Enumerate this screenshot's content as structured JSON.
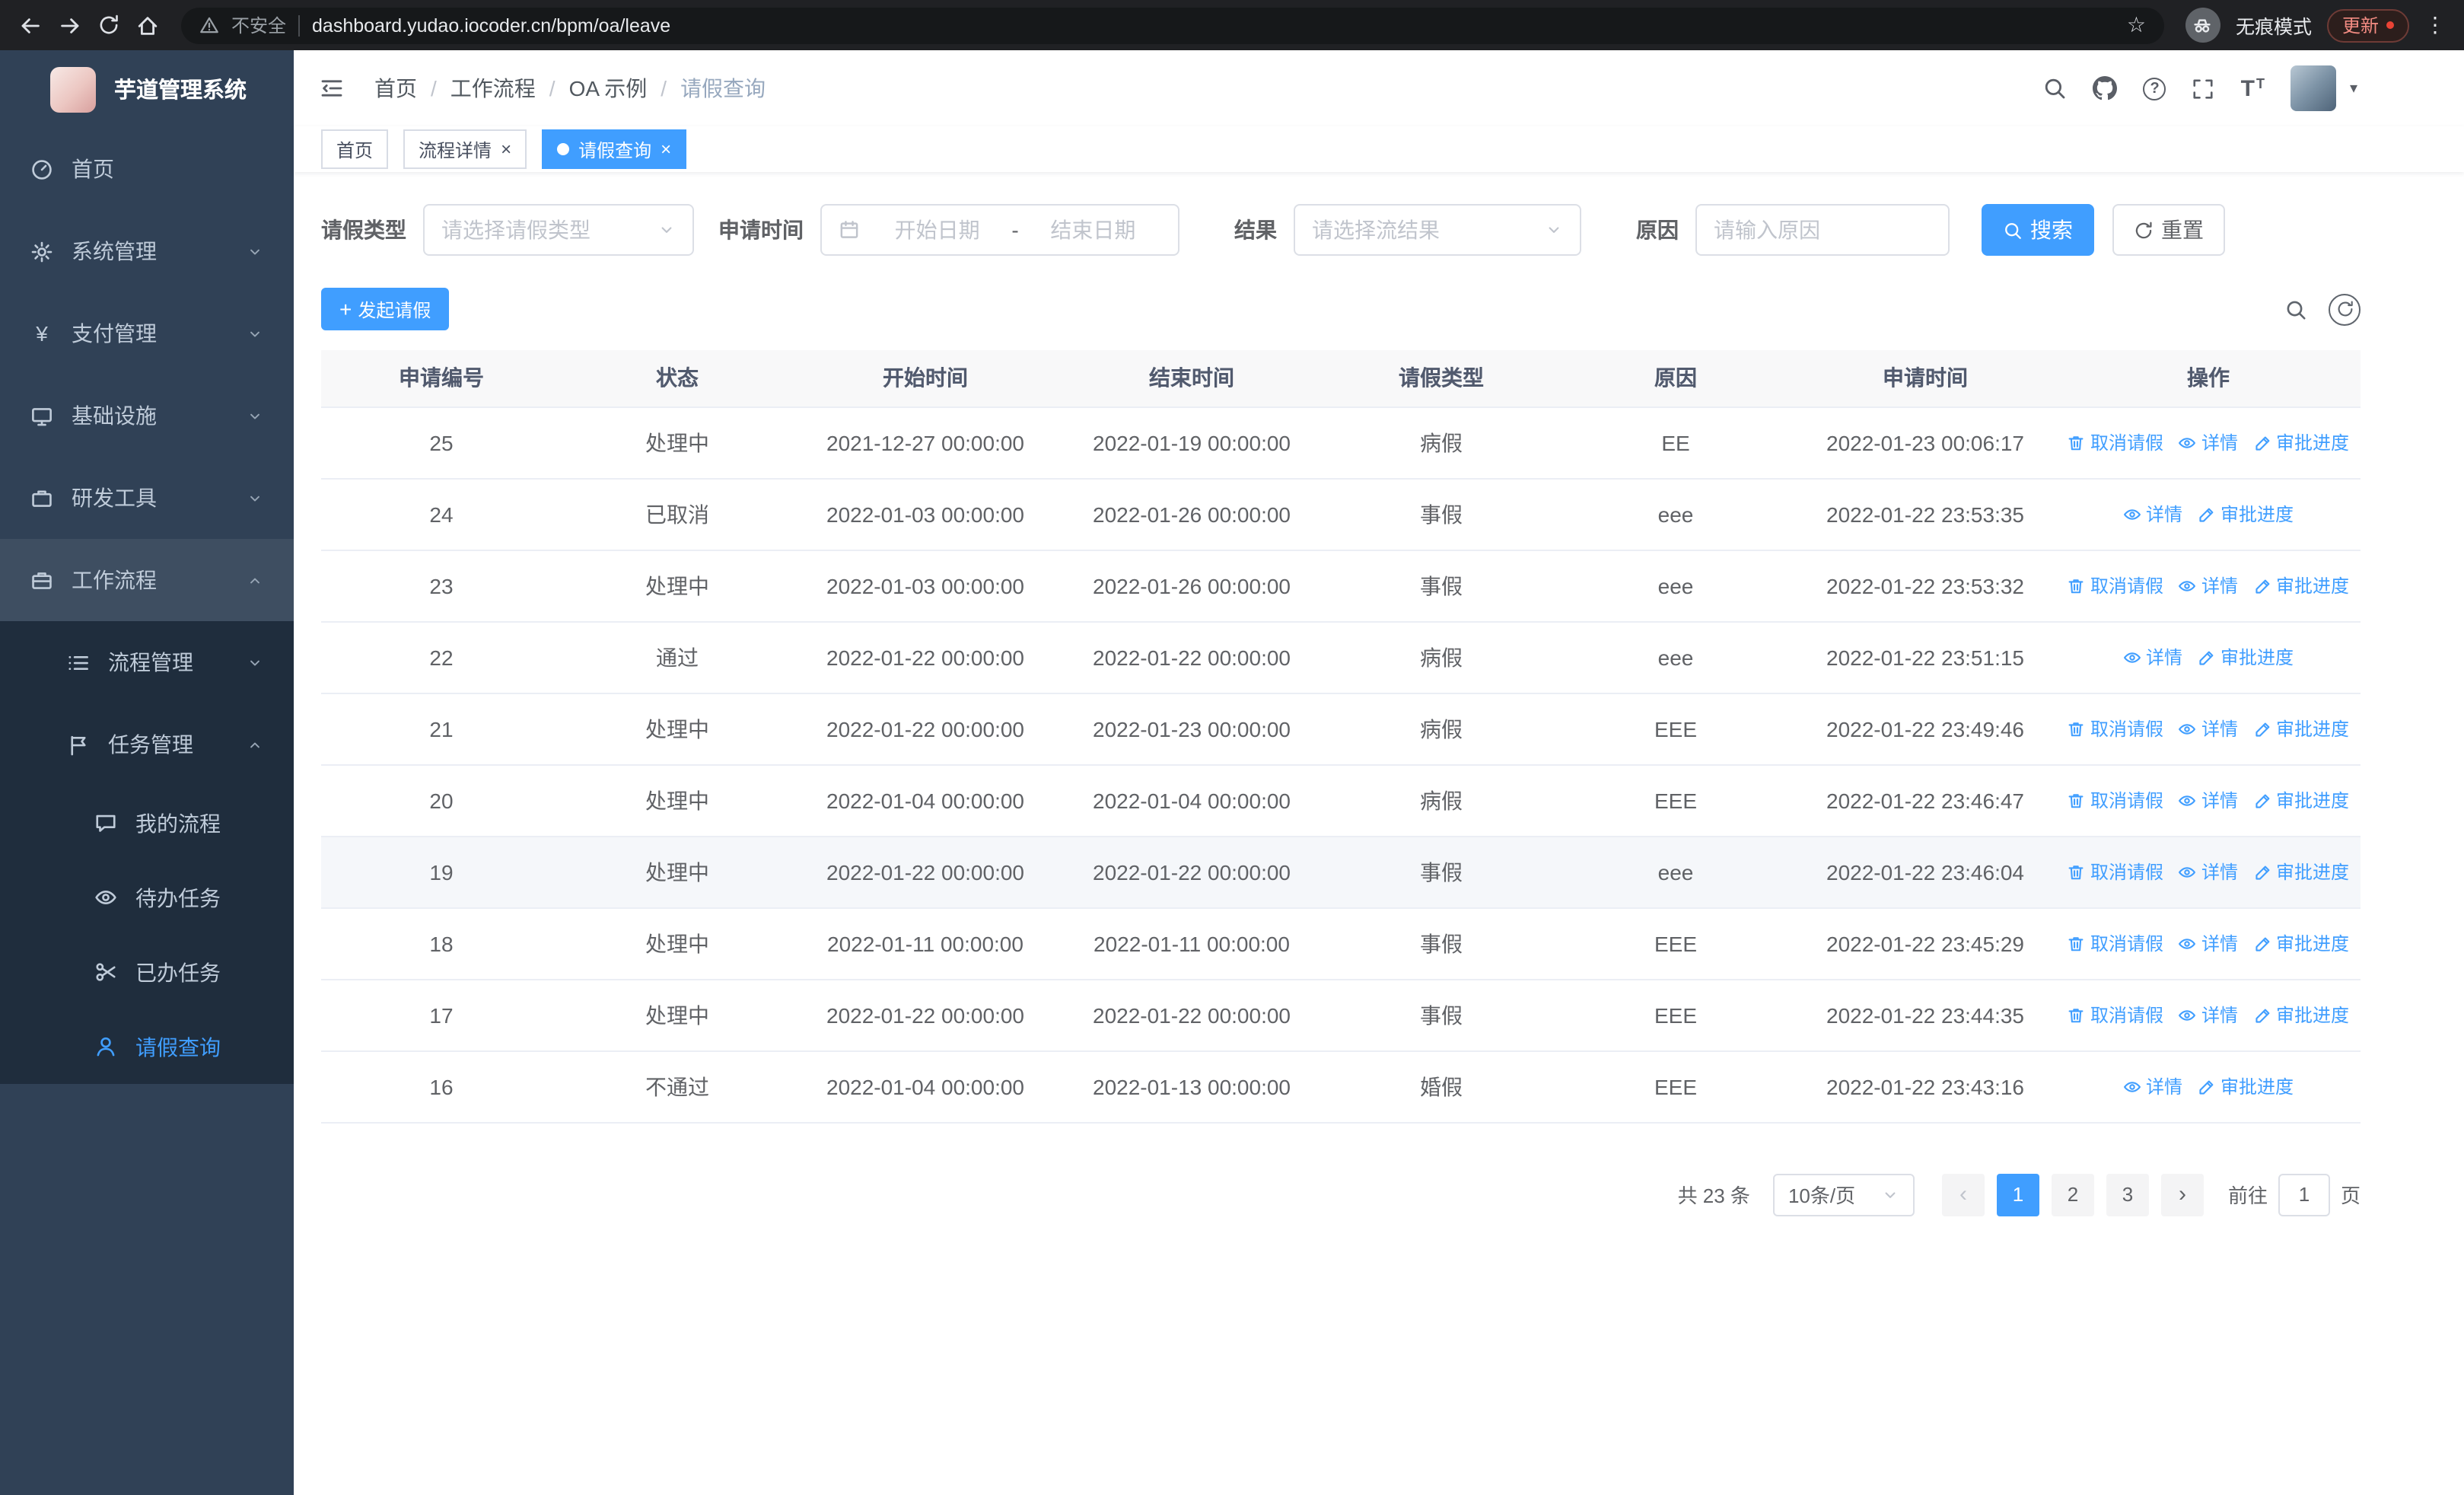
{
  "browser": {
    "security_label": "不安全",
    "url": "dashboard.yudao.iocoder.cn/bpm/oa/leave",
    "incognito_label": "无痕模式",
    "update_label": "更新"
  },
  "icons": {
    "plus": "+",
    "yen": "¥",
    "question": "?",
    "more_vert": "⋮",
    "star": "☆",
    "caret_down": "▾",
    "close": "×",
    "prev": "‹",
    "next": "›",
    "font_large": "T",
    "font_small": "T"
  },
  "app": {
    "title": "芋道管理系统"
  },
  "sidebar": {
    "items": [
      {
        "id": "home",
        "label": "首页",
        "icon": "dashboard",
        "depth": 0
      },
      {
        "id": "system",
        "label": "系统管理",
        "icon": "gear",
        "depth": 0,
        "chevron": "down"
      },
      {
        "id": "payment",
        "label": "支付管理",
        "icon": "yen",
        "depth": 0,
        "chevron": "down"
      },
      {
        "id": "infrastructure",
        "label": "基础设施",
        "icon": "monitor",
        "depth": 0,
        "chevron": "down"
      },
      {
        "id": "devtools",
        "label": "研发工具",
        "icon": "toolbox",
        "depth": 0,
        "chevron": "down"
      },
      {
        "id": "workflow",
        "label": "工作流程",
        "icon": "briefcase",
        "depth": 0,
        "chevron": "up",
        "highlight": true
      },
      {
        "id": "process-mgmt",
        "label": "流程管理",
        "icon": "list",
        "depth": 1,
        "chevron": "down",
        "sub": true
      },
      {
        "id": "task-mgmt",
        "label": "任务管理",
        "icon": "flag",
        "depth": 1,
        "chevron": "up",
        "sub": true
      },
      {
        "id": "my-process",
        "label": "我的流程",
        "icon": "chat",
        "depth": 2,
        "sub": true
      },
      {
        "id": "todo-task",
        "label": "待办任务",
        "icon": "eye",
        "depth": 2,
        "sub": true
      },
      {
        "id": "done-task",
        "label": "已办任务",
        "icon": "scissors",
        "depth": 2,
        "sub": true
      },
      {
        "id": "leave-query",
        "label": "请假查询",
        "icon": "user",
        "depth": 2,
        "sub": true,
        "active": true
      }
    ]
  },
  "header": {
    "breadcrumb": {
      "separator": "/",
      "items": [
        "首页",
        "工作流程",
        "OA 示例",
        "请假查询"
      ]
    }
  },
  "tabs": [
    {
      "id": "home",
      "label": "首页"
    },
    {
      "id": "process-detail",
      "label": "流程详情",
      "closable": true
    },
    {
      "id": "leave-query",
      "label": "请假查询",
      "closable": true,
      "active": true
    }
  ],
  "filters": {
    "leave_type_label": "请假类型",
    "leave_type_placeholder": "请选择请假类型",
    "apply_time_label": "申请时间",
    "start_date_placeholder": "开始日期",
    "date_separator": "-",
    "end_date_placeholder": "结束日期",
    "result_label": "结果",
    "result_placeholder": "请选择流结果",
    "reason_label": "原因",
    "reason_placeholder": "请输入原因",
    "search_label": "搜索",
    "reset_label": "重置"
  },
  "toolbar": {
    "create_label": "发起请假"
  },
  "table": {
    "columns": [
      "申请编号",
      "状态",
      "开始时间",
      "结束时间",
      "请假类型",
      "原因",
      "申请时间",
      "操作"
    ],
    "action_defs": {
      "cancel": {
        "label": "取消请假",
        "icon": "delete-icon"
      },
      "detail": {
        "label": "详情",
        "icon": "view-icon"
      },
      "progress": {
        "label": "审批进度",
        "icon": "edit-icon"
      }
    },
    "rows": [
      {
        "id": "25",
        "status": "处理中",
        "start": "2021-12-27 00:00:00",
        "end": "2022-01-19 00:00:00",
        "type": "病假",
        "reason": "EE",
        "applied": "2022-01-23 00:06:17",
        "actions": [
          "cancel",
          "detail",
          "progress"
        ]
      },
      {
        "id": "24",
        "status": "已取消",
        "start": "2022-01-03 00:00:00",
        "end": "2022-01-26 00:00:00",
        "type": "事假",
        "reason": "eee",
        "applied": "2022-01-22 23:53:35",
        "actions": [
          "detail",
          "progress"
        ]
      },
      {
        "id": "23",
        "status": "处理中",
        "start": "2022-01-03 00:00:00",
        "end": "2022-01-26 00:00:00",
        "type": "事假",
        "reason": "eee",
        "applied": "2022-01-22 23:53:32",
        "actions": [
          "cancel",
          "detail",
          "progress"
        ]
      },
      {
        "id": "22",
        "status": "通过",
        "start": "2022-01-22 00:00:00",
        "end": "2022-01-22 00:00:00",
        "type": "病假",
        "reason": "eee",
        "applied": "2022-01-22 23:51:15",
        "actions": [
          "detail",
          "progress"
        ]
      },
      {
        "id": "21",
        "status": "处理中",
        "start": "2022-01-22 00:00:00",
        "end": "2022-01-23 00:00:00",
        "type": "病假",
        "reason": "EEE",
        "applied": "2022-01-22 23:49:46",
        "actions": [
          "cancel",
          "detail",
          "progress"
        ]
      },
      {
        "id": "20",
        "status": "处理中",
        "start": "2022-01-04 00:00:00",
        "end": "2022-01-04 00:00:00",
        "type": "病假",
        "reason": "EEE",
        "applied": "2022-01-22 23:46:47",
        "actions": [
          "cancel",
          "detail",
          "progress"
        ]
      },
      {
        "id": "19",
        "status": "处理中",
        "start": "2022-01-22 00:00:00",
        "end": "2022-01-22 00:00:00",
        "type": "事假",
        "reason": "eee",
        "applied": "2022-01-22 23:46:04",
        "actions": [
          "cancel",
          "detail",
          "progress"
        ],
        "highlight": true
      },
      {
        "id": "18",
        "status": "处理中",
        "start": "2022-01-11 00:00:00",
        "end": "2022-01-11 00:00:00",
        "type": "事假",
        "reason": "EEE",
        "applied": "2022-01-22 23:45:29",
        "actions": [
          "cancel",
          "detail",
          "progress"
        ]
      },
      {
        "id": "17",
        "status": "处理中",
        "start": "2022-01-22 00:00:00",
        "end": "2022-01-22 00:00:00",
        "type": "事假",
        "reason": "EEE",
        "applied": "2022-01-22 23:44:35",
        "actions": [
          "cancel",
          "detail",
          "progress"
        ]
      },
      {
        "id": "16",
        "status": "不通过",
        "start": "2022-01-04 00:00:00",
        "end": "2022-01-13 00:00:00",
        "type": "婚假",
        "reason": "EEE",
        "applied": "2022-01-22 23:43:16",
        "actions": [
          "detail",
          "progress"
        ]
      }
    ]
  },
  "pagination": {
    "total_label": "共 23 条",
    "page_size_label": "10条/页",
    "pages": [
      "1",
      "2",
      "3"
    ],
    "active_page": "1",
    "goto_label": "前往",
    "goto_value": "1",
    "unit_label": "页"
  }
}
